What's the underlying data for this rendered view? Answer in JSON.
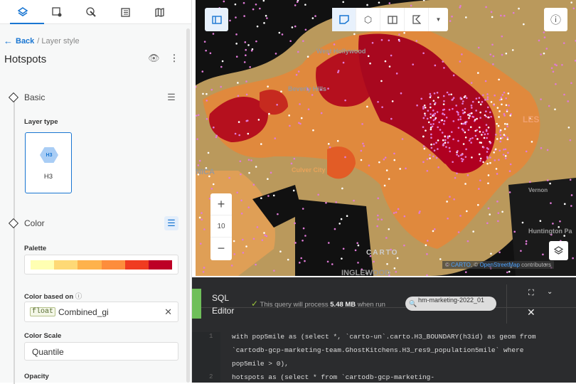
{
  "sidebar": {
    "tabs": [
      {
        "icon": "layers-icon",
        "active": true
      },
      {
        "icon": "widgets-icon"
      },
      {
        "icon": "interactions-icon"
      },
      {
        "icon": "table-icon"
      },
      {
        "icon": "basemap-icon"
      }
    ],
    "back": "Back",
    "breadcrumb": "/ Layer style",
    "title": "Hotspots",
    "basic": "Basic",
    "layer_type_label": "Layer type",
    "layer_type": "H3",
    "layer_type_badge": "H3",
    "color": "Color",
    "palette_label": "Palette",
    "palette": [
      "#ffffb2",
      "#fed976",
      "#feb24c",
      "#fd8d3c",
      "#f03b20",
      "#bd0026"
    ],
    "color_based_on_label": "Color based on",
    "color_field_type": "float",
    "color_field": "Combined_gi",
    "color_scale_label": "Color Scale",
    "color_scale": "Quantile",
    "opacity_label": "Opacity"
  },
  "map": {
    "labels": {
      "west_hollywood": "West Hollywood",
      "beverly_hills": "Beverly Hills",
      "culver_city": "Culver City",
      "nica": "NICA",
      "vernon": "Vernon",
      "huntington": "Huntington Pa",
      "inglewood": "INGLEWOOD",
      "les": "LES"
    },
    "zoom_level": "10",
    "logo": "CARTO",
    "attribution": {
      "prefix": "©",
      "carto": "CARTO",
      "sep": ", ©",
      "osm": "OpenStreetMap",
      "suffix": "contributors"
    }
  },
  "sql": {
    "title_line1": "SQL",
    "title_line2": "Editor",
    "status_pre": "This query will process",
    "status_size": "5.48 MB",
    "status_post": "when run",
    "connection": "hm-marketing-2022_01",
    "lines": [
      {
        "n": "1",
        "text": "with pop5mile as (select *, `carto-un`.carto.H3_BOUNDARY(h3id) as geom from"
      },
      {
        "n": "",
        "text": "`cartodb-gcp-marketing-team.GhostKitchens.H3_res9_population5mile` where"
      },
      {
        "n": "",
        "text": "pop5mile > 0),"
      },
      {
        "n": "2",
        "text": "hotspots as (select * from `cartodb-gcp-marketing-"
      }
    ]
  }
}
